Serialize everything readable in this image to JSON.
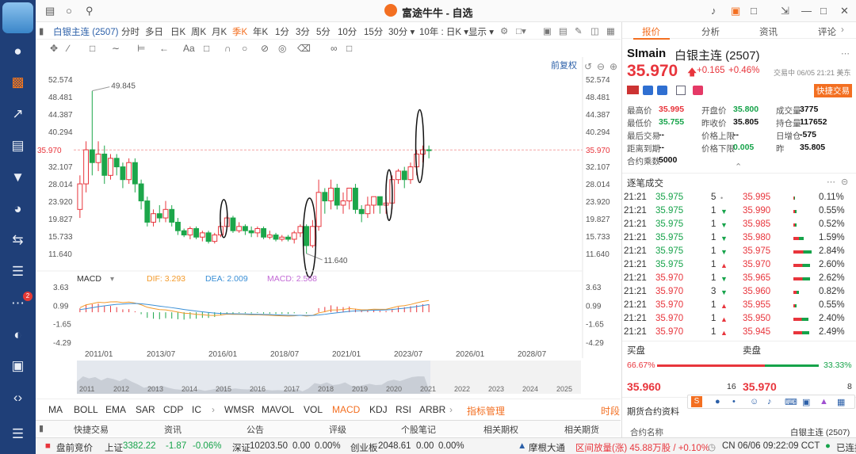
{
  "app": {
    "title": "富途牛牛 - 自选"
  },
  "nav": {
    "items": [
      "user-icon",
      "chart-icon",
      "trend-icon",
      "news-icon",
      "filter-icon",
      "pie-icon",
      "exchange-icon",
      "doc-icon",
      "chat-icon",
      "circle-icon",
      "game-icon",
      "code-icon",
      "menu-icon"
    ],
    "badge": "2"
  },
  "toolbar": {
    "symbol": "白银主连 (2507)",
    "periods": [
      "分时",
      "多日",
      "日K",
      "周K",
      "月K",
      "季K",
      "年K",
      "1分",
      "3分",
      "5分",
      "10分",
      "15分",
      "30分 ▾",
      "10年 : 日K ▾",
      "显示 ▾"
    ],
    "active": "季K"
  },
  "chart": {
    "adjust_label": "前复权",
    "price_axis": [
      "52.574",
      "48.481",
      "44.387",
      "40.294",
      "35.970",
      "32.107",
      "28.014",
      "23.920",
      "19.827",
      "15.733",
      "11.640"
    ],
    "current_price": "35.970",
    "high_label": "49.845",
    "low_label": "11.640"
  },
  "macd": {
    "name": "MACD",
    "dif_label": "DIF: 3.293",
    "dea_label": "DEA: 2.009",
    "macd_label": "MACD: 2.568",
    "axis": [
      "3.63",
      "0.99",
      "-1.65",
      "-4.29"
    ]
  },
  "x_axis": {
    "labels": [
      "2011/01",
      "2013/07",
      "2016/01",
      "2018/07",
      "2021/01",
      "2023/07",
      "2026/01",
      "2028/07"
    ]
  },
  "navigator": {
    "years": [
      "2011",
      "2012",
      "2013",
      "2014",
      "2015",
      "2016",
      "2017",
      "2018",
      "2019",
      "2020",
      "2021",
      "2022",
      "2023",
      "2024",
      "2025"
    ]
  },
  "indicators": {
    "items": [
      "MA",
      "BOLL",
      "EMA",
      "SAR",
      "CDP",
      "IC",
      "WMSR",
      "MAVOL",
      "VOL",
      "MACD",
      "KDJ",
      "RSI",
      "ARBR"
    ],
    "manage": "指标管理",
    "time": "时段",
    "active": "MACD"
  },
  "bottom_tabs": [
    "快捷交易",
    "资讯",
    "公告",
    "评级",
    "个股笔记",
    "相关期权",
    "相关期货"
  ],
  "status": {
    "market": "盘前竞价",
    "sh_label": "上证",
    "sh_value": "3382.22",
    "sh_change": "-1.87",
    "sh_pct": "-0.06%",
    "sz_label": "深证",
    "sz_value": "10203.50",
    "sz_change": "0.00",
    "sz_pct": "0.00%",
    "cy_label": "创业板",
    "cy_value": "2048.61",
    "cy_change": "0.00",
    "cy_pct": "0.00%",
    "morgan": "摩根大通",
    "amount": "区间放量(涨) 45.88万股 / +0.10%",
    "time": "CN 06/06 09:22:09 CCT",
    "conn": "已连接"
  },
  "quote": {
    "tabs": [
      "报价",
      "分析",
      "资讯",
      "评论"
    ],
    "code": "SImain",
    "name": "白银主连 (2507)",
    "price": "35.970",
    "change": "+0.165",
    "pct": "+0.46%",
    "trade_status": "交易中 06/05 21:21 美东",
    "quick_trade": "快捷交易",
    "fields": [
      [
        "最高价",
        "35.995"
      ],
      [
        "开盘价",
        "35.800"
      ],
      [
        "成交量",
        "3775"
      ],
      [
        "最低价",
        "35.755"
      ],
      [
        "昨收价",
        "35.805"
      ],
      [
        "持仓量",
        "117652"
      ],
      [
        "最后交易",
        "--"
      ],
      [
        "价格上限",
        "--"
      ],
      [
        "日增仓",
        "-575"
      ],
      [
        "距离到期",
        "--"
      ],
      [
        "价格下限",
        "0.005"
      ],
      [
        "昨",
        "35.805"
      ],
      [
        "合约乘数",
        "5000"
      ]
    ]
  },
  "ticks": {
    "title": "逐笔成交",
    "left": [
      [
        "21:21",
        "35.975",
        "5",
        "•"
      ],
      [
        "21:21",
        "35.975",
        "1",
        "▼"
      ],
      [
        "21:21",
        "35.975",
        "1",
        "▼"
      ],
      [
        "21:21",
        "35.975",
        "1",
        "▼"
      ],
      [
        "21:21",
        "35.975",
        "1",
        "▼"
      ],
      [
        "21:21",
        "35.975",
        "1",
        "▲"
      ],
      [
        "21:21",
        "35.970",
        "1",
        "▼"
      ],
      [
        "21:21",
        "35.970",
        "3",
        "▼"
      ],
      [
        "21:21",
        "35.970",
        "1",
        "▲"
      ],
      [
        "21:21",
        "35.970",
        "1",
        "▲"
      ],
      [
        "21:21",
        "35.970",
        "1",
        "▲"
      ]
    ],
    "right": [
      [
        "35.995",
        "0.11%"
      ],
      [
        "35.990",
        "0.55%"
      ],
      [
        "35.985",
        "0.52%"
      ],
      [
        "35.980",
        "1.59%"
      ],
      [
        "35.975",
        "2.84%"
      ],
      [
        "35.970",
        "2.60%"
      ],
      [
        "35.965",
        "2.62%"
      ],
      [
        "35.960",
        "0.82%"
      ],
      [
        "35.955",
        "0.55%"
      ],
      [
        "35.950",
        "2.40%"
      ],
      [
        "35.945",
        "2.49%"
      ]
    ]
  },
  "book": {
    "buy_label": "买盘",
    "sell_label": "卖盘",
    "buy_pct": "66.67%",
    "sell_pct": "33.33%",
    "bid": "35.960",
    "bid_size": "16",
    "ask": "35.970",
    "ask_size": "8"
  },
  "contract": {
    "title": "期货合约资料",
    "name_label": "合约名称",
    "name_value": "白银主连 (2507)"
  },
  "chart_data": {
    "type": "candlestick",
    "title": "白银主连 (2507) 季K",
    "ylim": [
      11.64,
      52.574
    ],
    "x_range": [
      "2011/01",
      "2025/06"
    ],
    "high": 49.845,
    "low": 11.64,
    "last": 35.97,
    "macd": {
      "dif": 3.293,
      "dea": 2.009,
      "macd": 2.568,
      "ylim": [
        -4.29,
        3.63
      ]
    },
    "candles": [
      [
        22,
        28,
        20,
        30
      ],
      [
        28,
        36,
        26,
        38
      ],
      [
        36,
        33,
        30,
        49.8
      ],
      [
        33,
        35,
        31,
        38
      ],
      [
        35,
        30,
        28,
        37
      ],
      [
        30,
        34,
        29,
        35
      ],
      [
        34,
        32,
        30,
        35
      ],
      [
        32,
        29,
        27,
        33
      ],
      [
        29,
        33,
        28,
        34
      ],
      [
        33,
        28,
        26,
        34
      ],
      [
        28,
        24,
        22,
        29
      ],
      [
        24,
        19,
        18,
        25
      ],
      [
        19,
        21,
        18,
        22
      ],
      [
        21,
        20,
        19,
        23
      ],
      [
        20,
        22,
        19,
        24
      ],
      [
        22,
        19,
        18,
        23
      ],
      [
        19,
        17,
        16,
        20
      ],
      [
        17,
        16,
        15.5,
        17.5
      ],
      [
        16,
        17.5,
        15,
        18
      ],
      [
        17.5,
        15.5,
        15,
        18
      ],
      [
        15.5,
        16.5,
        14.5,
        17
      ],
      [
        16.5,
        14.5,
        14,
        17
      ],
      [
        14.5,
        16,
        14,
        16.5
      ],
      [
        16,
        18,
        15.5,
        19
      ],
      [
        18,
        20,
        17.5,
        20.5
      ],
      [
        20,
        17,
        16.5,
        20.5
      ],
      [
        17,
        18,
        16.5,
        19
      ],
      [
        18,
        17,
        16,
        18.5
      ],
      [
        17,
        16.5,
        15.5,
        18
      ],
      [
        16.5,
        17.5,
        15.5,
        18
      ],
      [
        17.5,
        15.5,
        15,
        18
      ],
      [
        15.5,
        16,
        15,
        17
      ],
      [
        16,
        15,
        14.5,
        16.5
      ],
      [
        15,
        15.5,
        14.5,
        16
      ],
      [
        15.5,
        15,
        14.5,
        16
      ],
      [
        15,
        16.5,
        14,
        17
      ],
      [
        16.5,
        18,
        15.5,
        18.5
      ],
      [
        18,
        13.5,
        11.6,
        18.5
      ],
      [
        13.5,
        18,
        13,
        19.5
      ],
      [
        18,
        26,
        17,
        29
      ],
      [
        26,
        24,
        21,
        27
      ],
      [
        24,
        27,
        22,
        29
      ],
      [
        27,
        23,
        22,
        28
      ],
      [
        23,
        24,
        21,
        26
      ],
      [
        24,
        27,
        22,
        27
      ],
      [
        27,
        22,
        21,
        28
      ],
      [
        22,
        21,
        19,
        23
      ],
      [
        21,
        23,
        20,
        25
      ],
      [
        23,
        25,
        21,
        25
      ],
      [
        25,
        23,
        21,
        25
      ],
      [
        23,
        23.5,
        21,
        25
      ],
      [
        23.5,
        29,
        22,
        30
      ],
      [
        29,
        31,
        28,
        31.5
      ],
      [
        31,
        29,
        27,
        32
      ],
      [
        29,
        32,
        28,
        33
      ],
      [
        32,
        35,
        30,
        36
      ],
      [
        35,
        36,
        33,
        37
      ],
      [
        36,
        35.97,
        34,
        37
      ]
    ]
  }
}
